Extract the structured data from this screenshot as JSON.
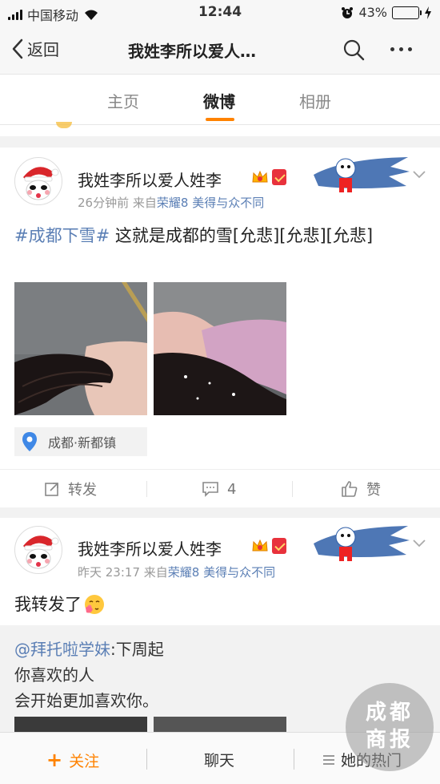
{
  "status_bar": {
    "carrier": "中国移动",
    "time": "12:44",
    "battery": "43%",
    "battery_level": 0.43
  },
  "nav": {
    "back_label": "返回",
    "title": "我姓李所以爱人…"
  },
  "tabs": [
    {
      "label": "主页"
    },
    {
      "label": "微博"
    },
    {
      "label": "相册"
    }
  ],
  "colors": {
    "accent": "#ff8200",
    "link": "#5b7fb5"
  },
  "posts": [
    {
      "username": "我姓李所以爱人姓李",
      "time": "26分钟前",
      "via": "来自",
      "source": "荣耀8 美得与众不同",
      "text_tag": "#成都下雪#",
      "text_body": " 这就是成都的雪[允悲][允悲][允悲]",
      "location": "成都·新都镇",
      "actions": {
        "repost": "转发",
        "comments": "4",
        "like": "赞"
      }
    },
    {
      "username": "我姓李所以爱人姓李",
      "time": "昨天 23:17",
      "via": "来自",
      "source": "荣耀8 美得与众不同",
      "text_body": "我转发了",
      "repost": {
        "mention": "@拜托啦学妹",
        "line1": ":下周起",
        "line2": "你喜欢的人",
        "line3": "会开始更加喜欢你。"
      }
    }
  ],
  "bottom_bar": {
    "follow": "关注",
    "chat": "聊天",
    "hot": "她的热门"
  },
  "watermark": {
    "line1": "成都",
    "line2": "商报"
  }
}
